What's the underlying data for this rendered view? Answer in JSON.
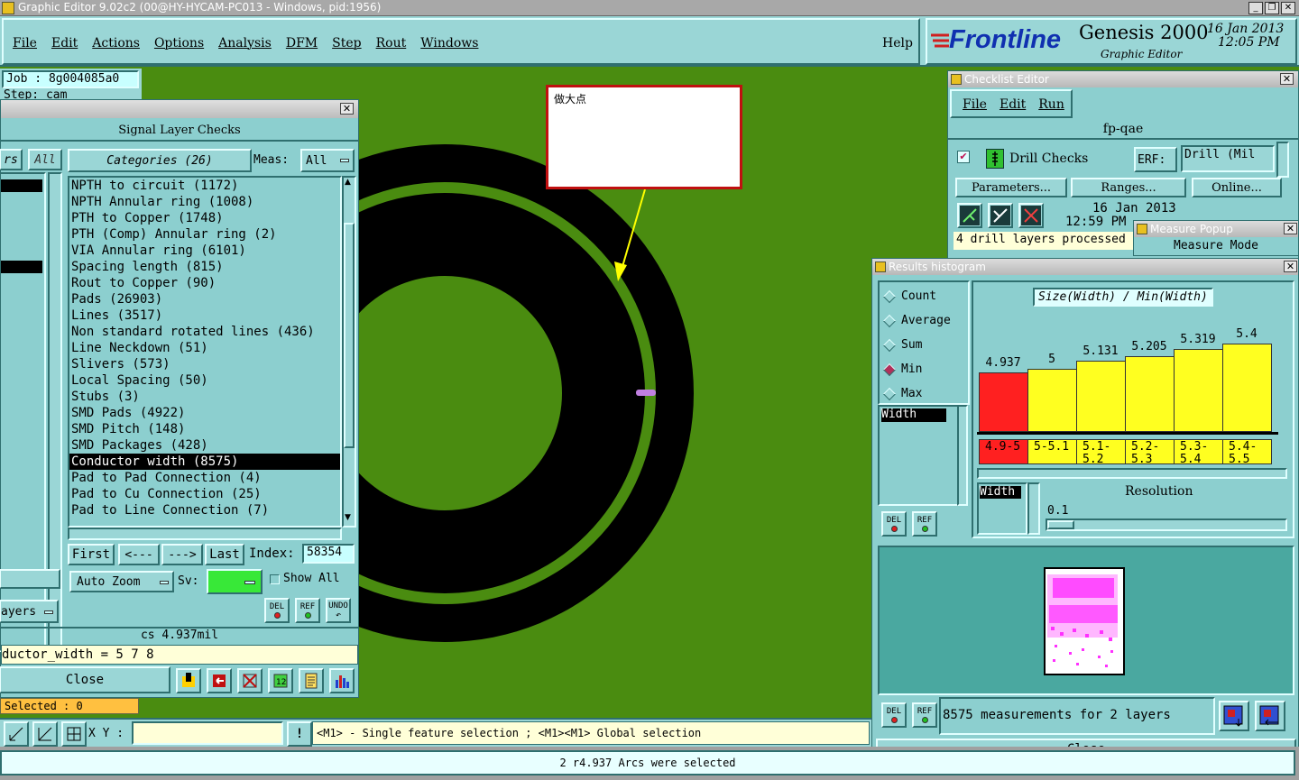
{
  "window": {
    "title": "Graphic Editor 9.02c2 (00@HY-HYCAM-PC013 - Windows, pid:1956)"
  },
  "menubar": {
    "items": [
      "File",
      "Edit",
      "Actions",
      "Options",
      "Analysis",
      "DFM",
      "Step",
      "Rout",
      "Windows"
    ],
    "help": "Help"
  },
  "brand": {
    "logo": "Frontline",
    "product": "Genesis 2000",
    "subtitle": "Graphic Editor",
    "date": "16 Jan 2013",
    "time": "12:05 PM"
  },
  "job_info": {
    "job": "Job : 8g004085a0",
    "step": "Step: cam"
  },
  "annotation": {
    "note": "做大点"
  },
  "signal_checks": {
    "title": "Signal Layer Checks",
    "left_header_partial": "rs",
    "left_all": "All",
    "categories_label": "Categories (26)",
    "meas_label": "Meas:",
    "meas_value": "All",
    "categories": [
      "NPTH to circuit (1172)",
      "NPTH Annular ring (1008)",
      "PTH to Copper (1748)",
      "PTH (Comp) Annular ring (2)",
      "VIA Annular ring (6101)",
      "Spacing length (815)",
      "Rout to Copper (90)",
      "Pads (26903)",
      "Lines (3517)",
      "Non standard rotated lines (436)",
      "Line Neckdown (51)",
      "Slivers (573)",
      "Local Spacing (50)",
      "Stubs (3)",
      "SMD Pads (4922)",
      "SMD Pitch (148)",
      "SMD Packages (428)",
      "Conductor width (8575)",
      "Pad to Pad Connection (4)",
      "Pad to Cu Connection (25)",
      "Pad to Line Connection (7)"
    ],
    "selected_index": 17,
    "nav": {
      "first": "First",
      "prev": "<---",
      "next": "--->",
      "last": "Last",
      "index_label": "Index:",
      "index_value": "58354"
    },
    "auto_zoom": "Auto Zoom",
    "sv_label": "Sv:",
    "show_all": "Show All",
    "layers_partial": "ayers",
    "status": "cs 4.937mil",
    "formula": "ductor_width = 5 7 8",
    "close": "Close",
    "del": "DEL",
    "ref": "REF",
    "undo": "UNDO"
  },
  "selected_count": "Selected : 0",
  "checklist_editor": {
    "title": "Checklist Editor",
    "menu": [
      "File",
      "Edit",
      "Run"
    ],
    "name": "fp-qae",
    "check_name": "Drill Checks",
    "erf_label": "ERF:",
    "erf_value": "Drill (Mil",
    "buttons": [
      "Parameters...",
      "Ranges...",
      "Online..."
    ],
    "date": "16 Jan 2013",
    "time": "12:59 PM",
    "message": "4 drill layers processed"
  },
  "measure_popup": {
    "title": "Measure Popup",
    "mode": "Measure Mode"
  },
  "histogram": {
    "title": "Results histogram",
    "options": [
      "Count",
      "Average",
      "Sum",
      "Min",
      "Max"
    ],
    "selected_option": "Min",
    "field": "Width",
    "chart_title": "Size(Width) / Min(Width)",
    "bars": [
      {
        "label": "4.937",
        "value": 4.937,
        "range": "4.9-5",
        "color": "#ff2020"
      },
      {
        "label": "5",
        "value": 5.0,
        "range": "5-5.1",
        "color": "#ffff20"
      },
      {
        "label": "5.131",
        "value": 5.131,
        "range": "5.1-5.2",
        "color": "#ffff20"
      },
      {
        "label": "5.205",
        "value": 5.205,
        "range": "5.2-5.3",
        "color": "#ffff20"
      },
      {
        "label": "5.319",
        "value": 5.319,
        "range": "5.3-5.4",
        "color": "#ffff20"
      },
      {
        "label": "5.4",
        "value": 5.4,
        "range": "5.4-5.5",
        "color": "#ffff20"
      }
    ],
    "width_label": "Width",
    "resolution_label": "Resolution",
    "resolution_value": "0.1",
    "summary": "8575 measurements for 2 layers",
    "close": "Close",
    "del": "DEL",
    "ref": "REF"
  },
  "bottom": {
    "xy_label": "X Y :",
    "hint": "<M1> - Single feature selection ; <M1><M1> Global selection",
    "status": "2 r4.937 Arcs were selected"
  },
  "colors": {
    "board": "#4a8c10",
    "panel": "#8ccfcf",
    "selected_bar": "#ff2020",
    "bar": "#ffff20",
    "accent_red": "#b0305a"
  }
}
